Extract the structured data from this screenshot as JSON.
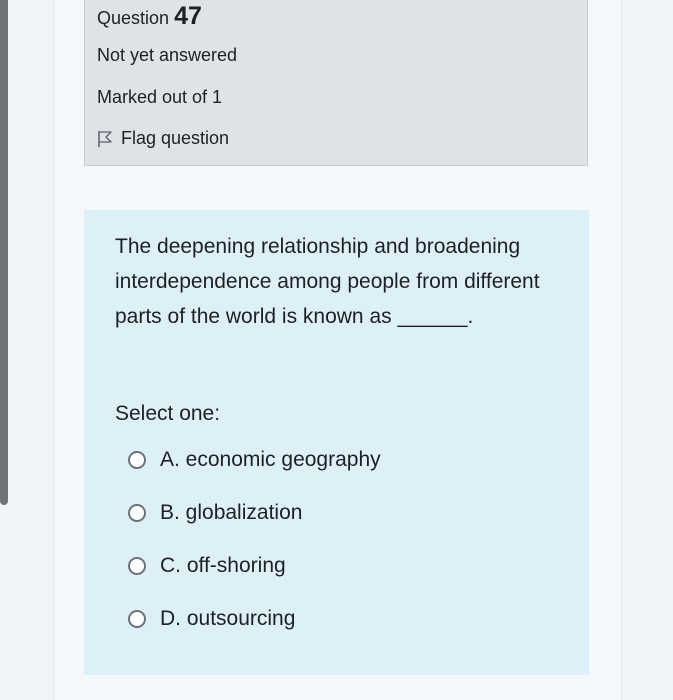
{
  "info": {
    "question_label": "Question",
    "question_number": "47",
    "status": "Not yet answered",
    "marks": "Marked out of 1",
    "flag_label": "Flag question"
  },
  "question": {
    "text": "The deepening relationship and broadening interdependence among people from different parts of the world is known as ______.",
    "prompt": "Select one:",
    "options": [
      {
        "label": "A. economic geography"
      },
      {
        "label": "B. globalization"
      },
      {
        "label": "C. off-shoring"
      },
      {
        "label": "D. outsourcing"
      }
    ]
  }
}
